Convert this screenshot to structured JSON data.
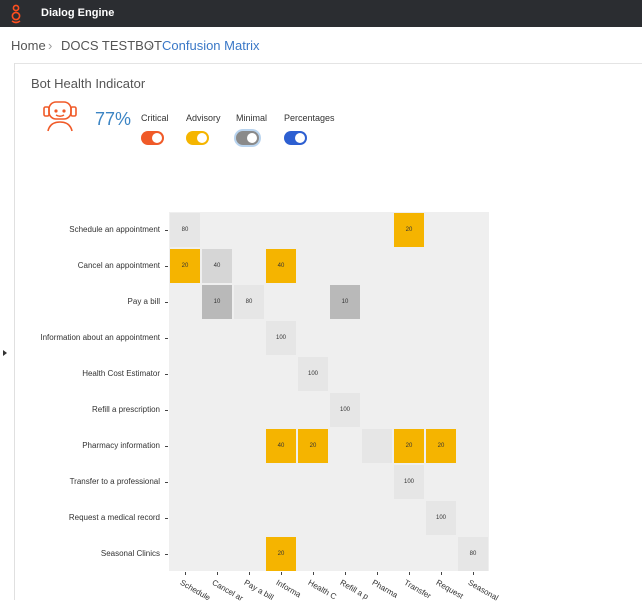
{
  "header": {
    "app_title": "Dialog Engine"
  },
  "breadcrumb": {
    "items": [
      "Home",
      "DOCS TESTBOT",
      "Confusion Matrix"
    ]
  },
  "bot_health": {
    "title": "Bot Health Indicator",
    "percentage": "77%",
    "toggles": [
      {
        "label": "Critical",
        "color": "#f05a28",
        "on": true
      },
      {
        "label": "Advisory",
        "color": "#f5b500",
        "on": true
      },
      {
        "label": "Minimal",
        "color": "#8a8a8a",
        "on": true
      },
      {
        "label": "Percentages",
        "color": "#2d5fd1",
        "on": true
      }
    ]
  },
  "colors": {
    "critical": "#f05a28",
    "advisory": "#f5b400",
    "minimal_dark": "#b9b9b9",
    "minimal_mid": "#d6d6d6",
    "minimal_light": "#e6e6e6",
    "empty": "#efefef"
  },
  "chart_data": {
    "type": "heatmap",
    "rows": [
      "Schedule an appointment",
      "Cancel an appointment",
      "Pay a bill",
      "Information about an appointment",
      "Health Cost Estimator",
      "Refill a prescription",
      "Pharmacy information",
      "Transfer to a professional",
      "Request a medical record",
      "Seasonal Clinics"
    ],
    "columns": [
      "Schedule an appointment",
      "Cancel an appointment",
      "Pay a bill",
      "Information about an appointment",
      "Health Cost Estimator",
      "Refill a prescription",
      "Pharmacy information",
      "Transfer to a professional",
      "Request a medical record",
      "Seasonal Clinics"
    ],
    "x_tick_labels": [
      "Schedule",
      "Cancel ar",
      "Pay a bill",
      "Informa",
      "Health C",
      "Refill a p",
      "Pharma",
      "Transfer",
      "Request",
      "Seasonal"
    ],
    "values": [
      [
        80,
        null,
        null,
        null,
        null,
        null,
        null,
        20,
        null,
        null
      ],
      [
        20,
        40,
        null,
        40,
        null,
        null,
        null,
        null,
        null,
        null
      ],
      [
        null,
        10,
        80,
        null,
        null,
        10,
        null,
        null,
        null,
        null
      ],
      [
        null,
        null,
        null,
        100,
        null,
        null,
        null,
        null,
        null,
        null
      ],
      [
        null,
        null,
        null,
        null,
        100,
        null,
        null,
        null,
        null,
        null
      ],
      [
        null,
        null,
        null,
        null,
        null,
        100,
        null,
        null,
        null,
        null
      ],
      [
        null,
        null,
        null,
        40,
        20,
        null,
        0,
        20,
        20,
        null
      ],
      [
        null,
        null,
        null,
        null,
        null,
        null,
        null,
        100,
        null,
        null
      ],
      [
        null,
        null,
        null,
        null,
        null,
        null,
        null,
        null,
        100,
        null
      ],
      [
        null,
        null,
        null,
        20,
        null,
        null,
        null,
        null,
        null,
        80
      ]
    ],
    "levels": [
      [
        "minimal_light",
        null,
        null,
        null,
        null,
        null,
        null,
        "advisory",
        null,
        null
      ],
      [
        "advisory",
        "minimal_mid",
        null,
        "advisory",
        null,
        null,
        null,
        null,
        null,
        null
      ],
      [
        null,
        "minimal_dark",
        "minimal_light",
        null,
        null,
        "minimal_dark",
        null,
        null,
        null,
        null
      ],
      [
        null,
        null,
        null,
        "minimal_light",
        null,
        null,
        null,
        null,
        null,
        null
      ],
      [
        null,
        null,
        null,
        null,
        "minimal_light",
        null,
        null,
        null,
        null,
        null
      ],
      [
        null,
        null,
        null,
        null,
        null,
        "minimal_light",
        null,
        null,
        null,
        null
      ],
      [
        null,
        null,
        null,
        "advisory",
        "advisory",
        null,
        "minimal_light",
        "advisory",
        "advisory",
        null
      ],
      [
        null,
        null,
        null,
        null,
        null,
        null,
        null,
        "minimal_light",
        null,
        null
      ],
      [
        null,
        null,
        null,
        null,
        null,
        null,
        null,
        null,
        "minimal_light",
        null
      ],
      [
        null,
        null,
        null,
        "advisory",
        null,
        null,
        null,
        null,
        null,
        "minimal_light"
      ]
    ]
  }
}
